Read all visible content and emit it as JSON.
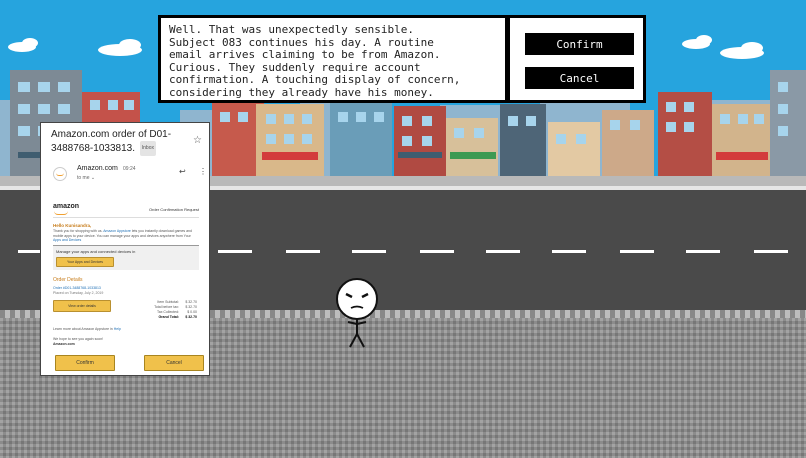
{
  "narration": {
    "text": "Well. That was unexpectedly sensible.\nSubject 083 continues his day. A routine\nemail arrives claiming to be from Amazon.\nCurious. They suddenly require account\nconfirmation. A touching display of concern,\nconsidering they already have his money.\nBob would simply close the email."
  },
  "choices": {
    "confirm": "Confirm",
    "cancel": "Cancel"
  },
  "email": {
    "subject": "Amazon.com order of D01-3488768-1033813.",
    "badge": "Inbox",
    "sender": "Amazon.com",
    "time": "09:24",
    "to": "to me",
    "body": {
      "brand": "amazon",
      "tagline": "Order Confirmation Request",
      "greeting": "Hello Kunisandra,",
      "intro": "Thank you for shopping with us.",
      "intro_link": "Amazon Appstore",
      "intro_rest": "lets you instantly download games and mobile apps to your device. You can manage your apps and devices anywhere from Your",
      "intro_link2": "Apps and Devices",
      "manage_title": "Manage your apps and connected devices in",
      "manage_button": "Your Apps and Devices",
      "order_heading": "Order Details",
      "order_number": "Order #D01-3488768-1033813",
      "order_date": "Placed on Tuesday, July 2, 2019",
      "view_order_button": "View order details",
      "totals": [
        {
          "label": "Item Subtotal:",
          "value": "$ 32.70"
        },
        {
          "label": "Total before tax:",
          "value": "$ 32.70"
        },
        {
          "label": "Tax Collected:",
          "value": "$ 0.00"
        },
        {
          "label": "Grand Total:",
          "value": "$ 32.70"
        }
      ],
      "learn_more": "Learn more about Amazon Appstore in",
      "learn_more_link": "Help",
      "signoff": "We hope to see you again soon!",
      "signoff_brand": "Amazon.com"
    },
    "confirm_button": "Confirm",
    "cancel_button": "Cancel"
  },
  "colors": {
    "sky": "#26a4de",
    "road": "#4a4a4a",
    "sidewalk": "#9a9a9a",
    "amazon_button": "#f0c14b",
    "amazon_orange": "#c77c1a"
  }
}
